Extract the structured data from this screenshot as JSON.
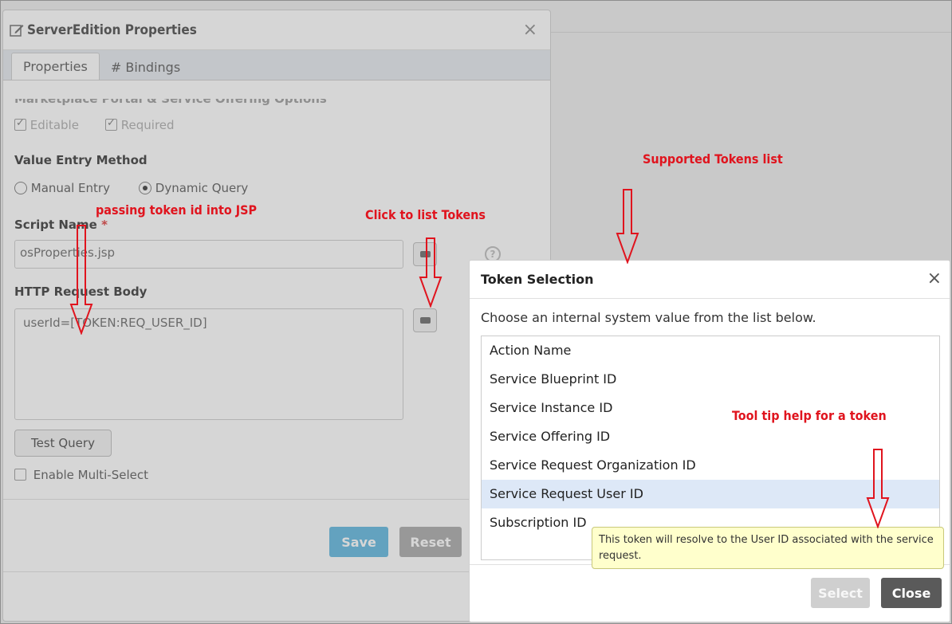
{
  "properties_dialog": {
    "title": "ServerEdition Properties",
    "close_glyph": "×",
    "tabs": [
      "Properties",
      "# Bindings"
    ],
    "section_marketplace": "Marketplace Portal & Service Offering Options",
    "editable_label": "Editable",
    "required_label": "Required",
    "value_entry_method_label": "Value Entry Method",
    "manual_entry_label": "Manual Entry",
    "dynamic_query_label": "Dynamic Query",
    "script_name_label": "Script Name",
    "required_star": "*",
    "script_name_value": "osProperties.jsp",
    "http_request_body_label": "HTTP Request Body",
    "http_request_body_value": "userId=[TOKEN:REQ_USER_ID]",
    "test_query_label": "Test Query",
    "enable_multiselect_label": "Enable Multi-Select",
    "save_label": "Save",
    "reset_label": "Reset",
    "help_glyph": "?"
  },
  "token_dialog": {
    "title": "Token Selection",
    "close_glyph": "×",
    "instruction": "Choose an internal system value from the list below.",
    "items": [
      "Action Name",
      "Service Blueprint ID",
      "Service Instance ID",
      "Service Offering ID",
      "Service Request Organization ID",
      "Service Request User ID",
      "Subscription ID"
    ],
    "selected_item": "Service Request User ID",
    "select_label": "Select",
    "close_label": "Close",
    "tooltip": "This token will resolve to the User ID associated with the service request."
  },
  "annotations": {
    "passing_token": "passing token id into JSP",
    "click_to_list": "Click to list Tokens",
    "supported_tokens": "Supported Tokens list",
    "tooltip_help": "Tool tip help for a token"
  },
  "colors": {
    "save_button": "#5bb5de",
    "reset_button": "#a7a7a7",
    "close_button": "#5a5a5a",
    "select_button_disabled": "#cfcfcf",
    "annotation_red": "#e0141e",
    "tooltip_bg": "#ffffcc",
    "selected_row": "#dde8f7"
  },
  "icons": [
    "edit-icon",
    "close-icon",
    "help-icon",
    "token-list-icon",
    "down-arrow-annotation"
  ]
}
